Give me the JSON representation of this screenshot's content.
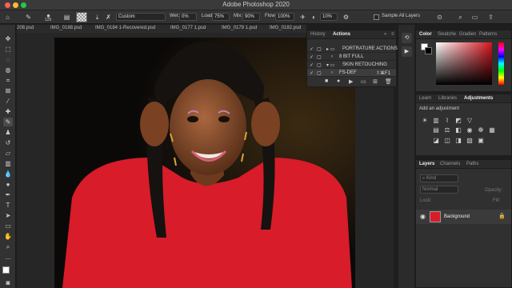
{
  "app": {
    "title": "Adobe Photoshop 2020"
  },
  "options_bar": {
    "brush_size": "125",
    "mode_value": "Custom",
    "wet_label": "Wet:",
    "wet_value": "0%",
    "load_label": "Load:",
    "load_value": "75%",
    "mix_label": "Mix:",
    "mix_value": "90%",
    "flow_label": "Flow:",
    "flow_value": "100%",
    "angle_value": "10%",
    "sample_all_layers": "Sample All Layers"
  },
  "document_tabs": [
    {
      "label": "208.psd"
    },
    {
      "label": "IMG_0188.psd"
    },
    {
      "label": "IMG_0184 1-Recovered.psd"
    },
    {
      "label": "IMG_0177 1.psd"
    },
    {
      "label": "IMG_0179 1.psd"
    },
    {
      "label": "IMG_0182.psd"
    }
  ],
  "actions_panel": {
    "tabs": [
      {
        "label": "History"
      },
      {
        "label": "Actions"
      }
    ],
    "rows": [
      {
        "label": "PORTRATURE ACTIONS",
        "type": "set"
      },
      {
        "label": "8 BIT FULL",
        "type": "action"
      },
      {
        "label": "SKIN RETOUCHING",
        "type": "set"
      },
      {
        "label": "FS-DEF",
        "shortcut": "⇧⌘F1",
        "type": "action"
      }
    ]
  },
  "color_panel": {
    "tabs": [
      {
        "label": "Color"
      },
      {
        "label": "Swatche"
      },
      {
        "label": "Gradien"
      },
      {
        "label": "Patterns"
      }
    ],
    "picked_hue": "#d8141e"
  },
  "adjustments_panel": {
    "tabs": [
      {
        "label": "Learn"
      },
      {
        "label": "Libraries"
      },
      {
        "label": "Adjustments"
      }
    ],
    "hint": "Add an adjustment"
  },
  "layers_panel": {
    "tabs": [
      {
        "label": "Layers"
      },
      {
        "label": "Channels"
      },
      {
        "label": "Paths"
      }
    ],
    "filter_label": "Kind",
    "blend_mode": "Normal",
    "opacity_label": "Opacity:",
    "lock_label": "Lock:",
    "fill_label": "Fill:",
    "layers": [
      {
        "name": "Background"
      }
    ]
  },
  "colors": {
    "accent": "#2d6fd6",
    "bg": "#1e1e1e",
    "panel": "#303030"
  }
}
